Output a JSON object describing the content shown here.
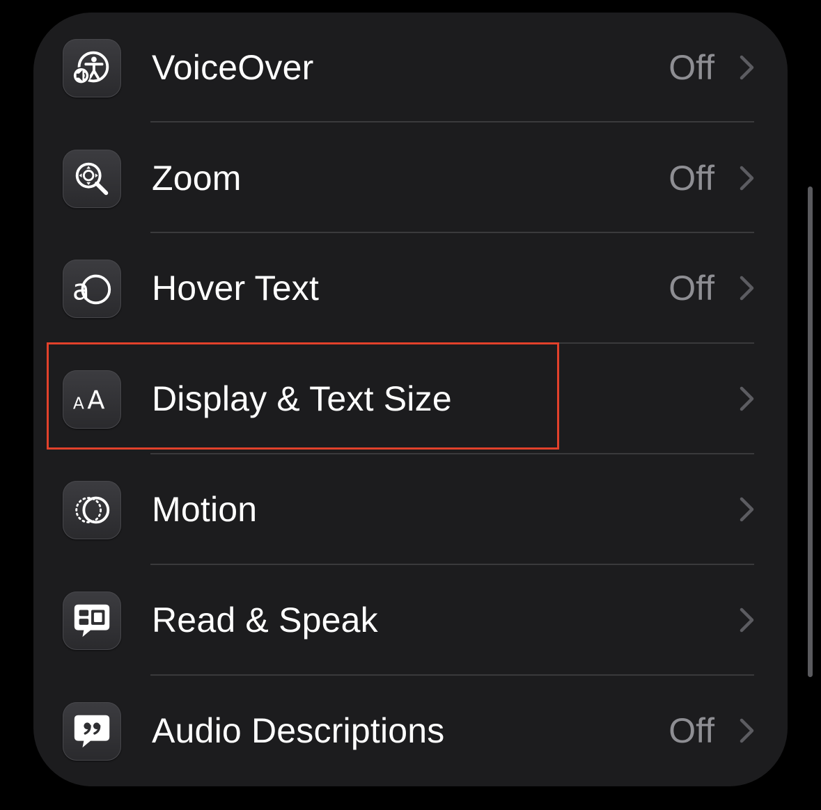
{
  "settings_group": {
    "rows": [
      {
        "label": "VoiceOver",
        "value": "Off",
        "icon": "voiceover-icon"
      },
      {
        "label": "Zoom",
        "value": "Off",
        "icon": "zoom-icon"
      },
      {
        "label": "Hover Text",
        "value": "Off",
        "icon": "hover-text-icon"
      },
      {
        "label": "Display & Text Size",
        "value": "",
        "icon": "display-text-size-icon"
      },
      {
        "label": "Motion",
        "value": "",
        "icon": "motion-icon"
      },
      {
        "label": "Read & Speak",
        "value": "",
        "icon": "read-speak-icon"
      },
      {
        "label": "Audio Descriptions",
        "value": "Off",
        "icon": "audio-descriptions-icon"
      }
    ]
  },
  "colors": {
    "background": "#000000",
    "group_background": "#1c1c1e",
    "label": "#ffffff",
    "value": "#8e8e93",
    "separator": "#3a3a3c",
    "highlight_box": "#e2412b"
  }
}
